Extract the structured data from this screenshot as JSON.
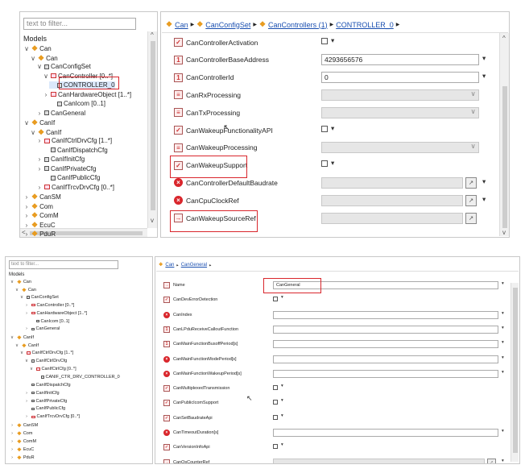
{
  "top": {
    "filter_placeholder": "text to filter...",
    "tree_title": "Models",
    "tree": [
      {
        "label": "Can",
        "tw": "v",
        "icon": "pkg"
      },
      {
        "label": "Can",
        "tw": "v",
        "icon": "pkg"
      },
      {
        "label": "CanConfigSet",
        "tw": "v",
        "icon": "cont"
      },
      {
        "label": "CanController [0..*]",
        "tw": "v",
        "icon": "list"
      },
      {
        "label": "CONTROLLER_0",
        "tw": "",
        "icon": "cont"
      },
      {
        "label": "CanHardwareObject [1..*]",
        "tw": ">",
        "icon": "list"
      },
      {
        "label": "CanIcom [0..1]",
        "tw": "",
        "icon": "cont"
      },
      {
        "label": "CanGeneral",
        "tw": ">",
        "icon": "cont"
      },
      {
        "label": "CanIf",
        "tw": "v",
        "icon": "pkg"
      },
      {
        "label": "CanIf",
        "tw": "v",
        "icon": "pkg"
      },
      {
        "label": "CanIfCtrlDrvCfg [1..*]",
        "tw": ">",
        "icon": "list"
      },
      {
        "label": "CanIfDispatchCfg",
        "tw": "",
        "icon": "cont"
      },
      {
        "label": "CanIfInitCfg",
        "tw": ">",
        "icon": "cont"
      },
      {
        "label": "CanIfPrivateCfg",
        "tw": ">",
        "icon": "cont"
      },
      {
        "label": "CanIfPublicCfg",
        "tw": "",
        "icon": "cont"
      },
      {
        "label": "CanIfTrcvDrvCfg [0..*]",
        "tw": ">",
        "icon": "list"
      },
      {
        "label": "CanSM",
        "tw": ">",
        "icon": "pkg"
      },
      {
        "label": "Com",
        "tw": ">",
        "icon": "pkg"
      },
      {
        "label": "ComM",
        "tw": ">",
        "icon": "pkg"
      },
      {
        "label": "EcuC",
        "tw": ">",
        "icon": "pkg"
      },
      {
        "label": "PduR",
        "tw": ">",
        "icon": "pkg"
      }
    ],
    "breadcrumb": [
      "Can",
      "CanConfigSet",
      "CanControllers (1)",
      "CONTROLLER_0"
    ],
    "params": [
      {
        "label": "CanControllerActivation",
        "icon": "cfg",
        "value": "",
        "kind": "check"
      },
      {
        "label": "CanControllerBaseAddress",
        "icon": "num",
        "value": "4293656576",
        "kind": "text"
      },
      {
        "label": "CanControllerId",
        "icon": "num",
        "value": "0",
        "kind": "text"
      },
      {
        "label": "CanRxProcessing",
        "icon": "enum",
        "value": "",
        "kind": "combo"
      },
      {
        "label": "CanTxProcessing",
        "icon": "enum",
        "value": "",
        "kind": "combo"
      },
      {
        "label": "CanWakeupFunctionalityAPI",
        "icon": "cfg",
        "value": "",
        "kind": "check"
      },
      {
        "label": "CanWakeupProcessing",
        "icon": "enum",
        "value": "",
        "kind": "combo"
      },
      {
        "label": "CanWakeupSupport",
        "icon": "cfg",
        "value": "",
        "kind": "check"
      },
      {
        "label": "CanControllerDefaultBaudrate",
        "icon": "err",
        "value": "",
        "kind": "ref"
      },
      {
        "label": "CanCpuClockRef",
        "icon": "err",
        "value": "",
        "kind": "ref"
      },
      {
        "label": "CanWakeupSourceRef",
        "icon": "ref",
        "value": "",
        "kind": "refonly"
      }
    ]
  },
  "bottom": {
    "filter_placeholder": "text to filter...",
    "tree_title": "Models",
    "tree": [
      {
        "label": "Can",
        "tw": "v",
        "icon": "pkg"
      },
      {
        "label": "Can",
        "tw": "v",
        "icon": "pkg"
      },
      {
        "label": "CanConfigSet",
        "tw": "v",
        "icon": "cont"
      },
      {
        "label": "CanController [0..*]",
        "tw": ">",
        "icon": "list"
      },
      {
        "label": "CanHardwareObject [1..*]",
        "tw": ">",
        "icon": "list"
      },
      {
        "label": "CanIcom [0..1]",
        "tw": "",
        "icon": "cont"
      },
      {
        "label": "CanGeneral",
        "tw": ">",
        "icon": "cont"
      },
      {
        "label": "CanIf",
        "tw": "v",
        "icon": "pkg"
      },
      {
        "label": "CanIf",
        "tw": "v",
        "icon": "pkg"
      },
      {
        "label": "CanIfCtrlDrvCfg [1..*]",
        "tw": "v",
        "icon": "list"
      },
      {
        "label": "CanIfCtrlDrvCfg",
        "tw": "v",
        "icon": "cont"
      },
      {
        "label": "CanIfCtrlCfg [0..*]",
        "tw": "v",
        "icon": "list"
      },
      {
        "label": "CANIF_CTR_DRV_CONTROLLER_0",
        "tw": "",
        "icon": "cont"
      },
      {
        "label": "CanIfDispatchCfg",
        "tw": "",
        "icon": "cont"
      },
      {
        "label": "CanIfInitCfg",
        "tw": ">",
        "icon": "cont"
      },
      {
        "label": "CanIfPrivateCfg",
        "tw": ">",
        "icon": "cont"
      },
      {
        "label": "CanIfPublicCfg",
        "tw": "",
        "icon": "cont"
      },
      {
        "label": "CanIfTrcvDrvCfg [0..*]",
        "tw": ">",
        "icon": "list"
      },
      {
        "label": "CanSM",
        "tw": ">",
        "icon": "pkg"
      },
      {
        "label": "Com",
        "tw": ">",
        "icon": "pkg"
      },
      {
        "label": "ComM",
        "tw": ">",
        "icon": "pkg"
      },
      {
        "label": "EcuC",
        "tw": ">",
        "icon": "pkg"
      },
      {
        "label": "PduR",
        "tw": ">",
        "icon": "pkg"
      }
    ],
    "breadcrumb": [
      "Can",
      "CanGeneral"
    ],
    "params": [
      {
        "label": "Name",
        "icon": "ref",
        "value": "CanGeneral",
        "kind": "text"
      },
      {
        "label": "CanDevErrorDetection",
        "icon": "cfg",
        "value": "",
        "kind": "check"
      },
      {
        "label": "CanIndex",
        "icon": "err",
        "value": "",
        "kind": "text"
      },
      {
        "label": "CanLPduReceiveCalloutFunction",
        "icon": "num",
        "value": "",
        "kind": "text"
      },
      {
        "label": "CanMainFunctionBusoffPeriod[s]",
        "icon": "num",
        "value": "",
        "kind": "text"
      },
      {
        "label": "CanMainFunctionModePeriod[s]",
        "icon": "err",
        "value": "",
        "kind": "text"
      },
      {
        "label": "CanMainFunctionWakeupPeriod[s]",
        "icon": "err",
        "value": "",
        "kind": "text"
      },
      {
        "label": "CanMultiplexedTransmission",
        "icon": "cfg",
        "value": "",
        "kind": "check"
      },
      {
        "label": "CanPublicIcomSupport",
        "icon": "cfg",
        "value": "",
        "kind": "check"
      },
      {
        "label": "CanSetBaudrateApi",
        "icon": "cfg",
        "value": "",
        "kind": "checked"
      },
      {
        "label": "CanTimeoutDuration[s]",
        "icon": "err",
        "value": "",
        "kind": "text"
      },
      {
        "label": "CanVersionInfoApi",
        "icon": "cfg",
        "value": "",
        "kind": "check"
      },
      {
        "label": "CanOsCounterRef",
        "icon": "ref",
        "value": "",
        "kind": "ref"
      }
    ]
  }
}
